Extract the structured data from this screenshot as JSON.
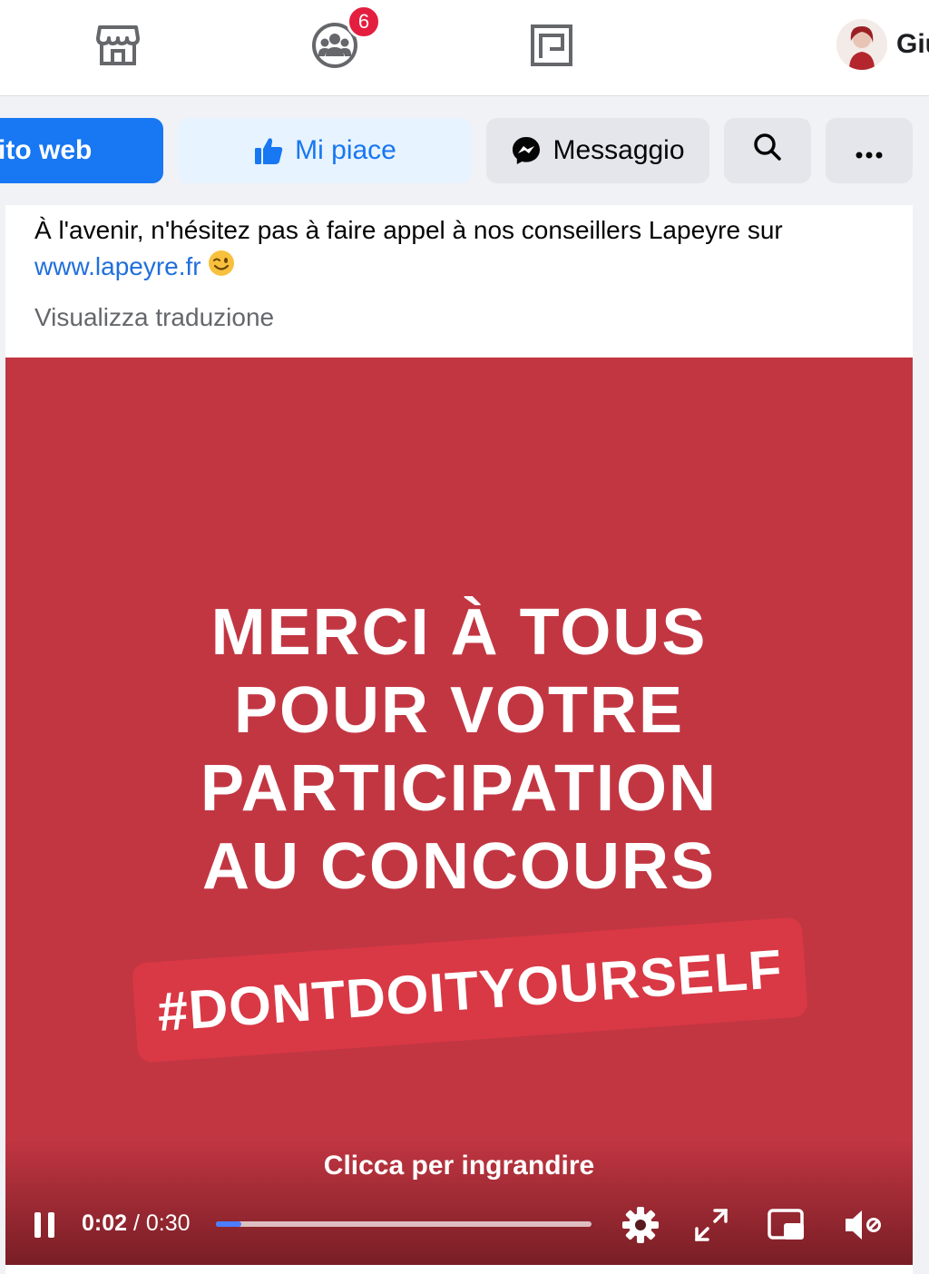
{
  "nav": {
    "notification_count": "6",
    "profile_name": "Giu"
  },
  "actions": {
    "site_label": "ito web",
    "like_label": "Mi piace",
    "message_label": "Messaggio"
  },
  "post": {
    "text": "À l'avenir, n'hésitez pas à faire appel à nos conseillers Lapeyre sur",
    "link": "www.lapeyre.fr",
    "translate_label": "Visualizza traduzione"
  },
  "video": {
    "headline": [
      "MERCI À TOUS",
      "POUR VOTRE",
      "PARTICIPATION",
      "AU CONCOURS"
    ],
    "hashtag": "#DONTDOITYOURSELF",
    "zoom_hint": "Clicca per ingrandire",
    "current_time": "0:02",
    "time_separator": " / ",
    "duration": "0:30",
    "progress_fraction": 0.0667
  },
  "colors": {
    "accent": "#1877f2",
    "video_bg": "#c23642",
    "badge": "#e41e3f"
  },
  "icons": [
    "store-icon",
    "groups-icon",
    "gaming-icon",
    "like-icon",
    "messenger-icon",
    "search-icon",
    "more-icon",
    "pause-icon",
    "settings-icon",
    "fullscreen-icon",
    "picture-in-picture-icon",
    "volume-icon"
  ]
}
